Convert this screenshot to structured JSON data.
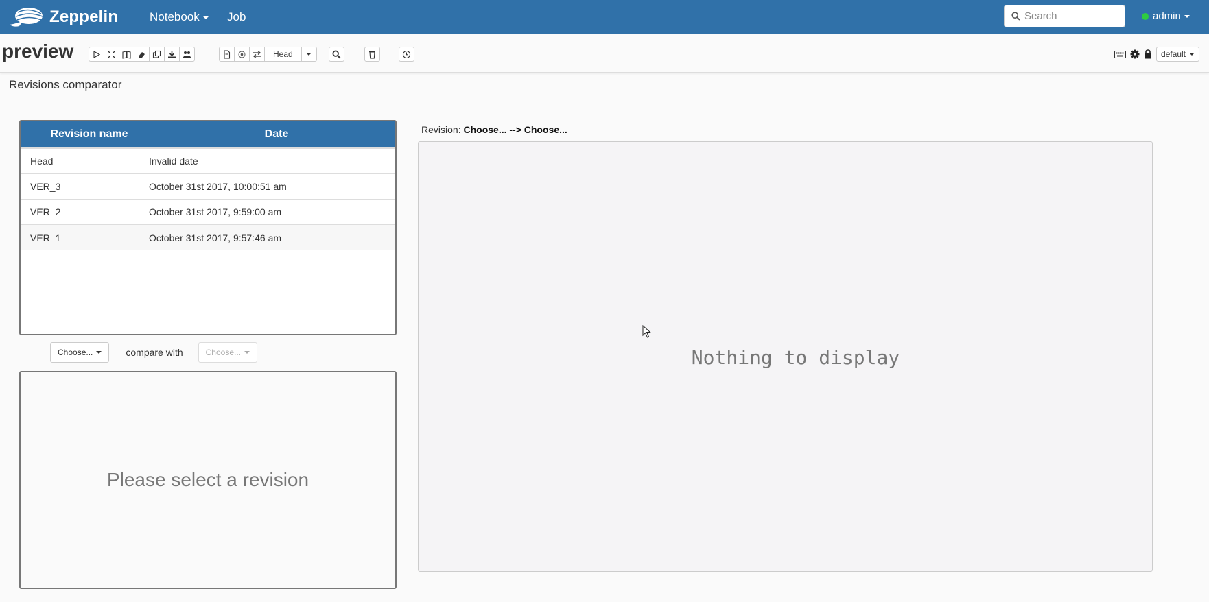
{
  "navbar": {
    "brand": "Zeppelin",
    "menu": [
      {
        "label": "Notebook",
        "has_caret": true
      },
      {
        "label": "Job",
        "has_caret": false
      }
    ],
    "search_placeholder": "Search",
    "user": "admin",
    "user_status_color": "#2ecc40",
    "bg_color": "#3071a9"
  },
  "note": {
    "title": "preview",
    "revision_selector": "Head",
    "interpreter_binding": "default",
    "toolbar_icons": [
      "run-all-icon",
      "show-hide-code-icon",
      "show-hide-output-icon",
      "clear-output-icon",
      "clone-icon",
      "export-icon",
      "version-control-icon",
      "commit-icon",
      "compare-revisions-icon",
      "revision-dropdown-icon",
      "search-code-icon",
      "trash-icon",
      "scheduler-icon"
    ],
    "right_icons": [
      "keyboard-icon",
      "gear-icon",
      "lock-icon"
    ]
  },
  "comparator": {
    "title": "Revisions comparator",
    "columns": [
      "Revision name",
      "Date"
    ],
    "rows": [
      {
        "name": "Head",
        "date": "Invalid date"
      },
      {
        "name": "VER_3",
        "date": "October 31st 2017, 10:00:51 am"
      },
      {
        "name": "VER_2",
        "date": "October 31st 2017, 9:59:00 am"
      },
      {
        "name": "VER_1",
        "date": "October 31st 2017, 9:57:46 am"
      }
    ],
    "choose_left": "Choose...",
    "compare_with": "compare with",
    "choose_right": "Choose...",
    "select_message": "Please select a revision",
    "revision_label": "Revision:",
    "revision_value": "Choose... --> Choose...",
    "diff_message": "Nothing to display"
  }
}
